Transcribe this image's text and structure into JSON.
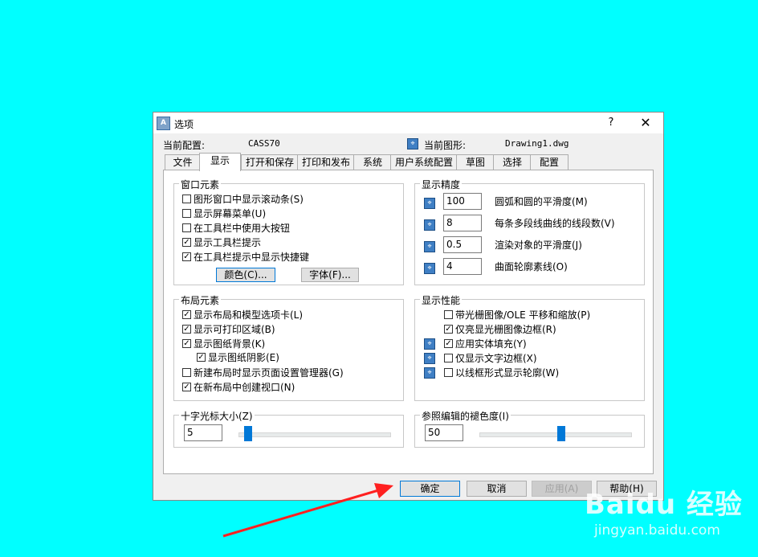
{
  "dialog": {
    "title": "选项",
    "help_label": "?",
    "close_label": "✕",
    "app_icon_label": "A"
  },
  "profile": {
    "current_config_label": "当前配置:",
    "current_config_value": "CASS70",
    "current_drawing_label": "当前图形:",
    "current_drawing_value": "Drawing1.dwg"
  },
  "tabs": [
    "文件",
    "显示",
    "打开和保存",
    "打印和发布",
    "系统",
    "用户系统配置",
    "草图",
    "选择",
    "配置"
  ],
  "active_tab": "显示",
  "window_elements": {
    "title": "窗口元素",
    "items": [
      {
        "label": "图形窗口中显示滚动条(S)",
        "checked": false
      },
      {
        "label": "显示屏幕菜单(U)",
        "checked": false
      },
      {
        "label": "在工具栏中使用大按钮",
        "checked": false
      },
      {
        "label": "显示工具栏提示",
        "checked": true
      },
      {
        "label": "在工具栏提示中显示快捷键",
        "checked": true
      }
    ],
    "colors_button": "颜色(C)...",
    "fonts_button": "字体(F)..."
  },
  "layout_elements": {
    "title": "布局元素",
    "items": [
      {
        "label": "显示布局和模型选项卡(L)",
        "checked": true
      },
      {
        "label": "显示可打印区域(B)",
        "checked": true
      },
      {
        "label": "显示图纸背景(K)",
        "checked": true
      },
      {
        "label": "显示图纸阴影(E)",
        "checked": true
      },
      {
        "label": "新建布局时显示页面设置管理器(G)",
        "checked": false
      },
      {
        "label": "在新布局中创建视口(N)",
        "checked": true
      }
    ]
  },
  "crosshair": {
    "title": "十字光标大小(Z)",
    "value": "5",
    "slider_fraction": 0.05
  },
  "display_resolution": {
    "title": "显示精度",
    "items": [
      {
        "value": "100",
        "label": "圆弧和圆的平滑度(M)"
      },
      {
        "value": "8",
        "label": "每条多段线曲线的线段数(V)"
      },
      {
        "value": "0.5",
        "label": "渲染对象的平滑度(J)"
      },
      {
        "value": "4",
        "label": "曲面轮廓素线(O)"
      }
    ]
  },
  "display_performance": {
    "title": "显示性能",
    "items": [
      {
        "label": "带光栅图像/OLE 平移和缩放(P)",
        "checked": false,
        "icon": false
      },
      {
        "label": "仅亮显光栅图像边框(R)",
        "checked": true,
        "icon": false
      },
      {
        "label": "应用实体填充(Y)",
        "checked": true,
        "icon": true
      },
      {
        "label": "仅显示文字边框(X)",
        "checked": false,
        "icon": true
      },
      {
        "label": "以线框形式显示轮廓(W)",
        "checked": false,
        "icon": true
      }
    ]
  },
  "xref_fade": {
    "title": "参照编辑的褪色度(I)",
    "value": "50",
    "slider_fraction": 0.5
  },
  "buttons": {
    "ok": "确定",
    "cancel": "取消",
    "apply": "应用(A)",
    "help": "帮助(H)"
  },
  "watermark": {
    "brand": "Baidu 经验",
    "url": "jingyan.baidu.com"
  },
  "colors": {
    "background": "#00ffff",
    "slider_thumb": "#0078d7",
    "arrow": "#ff2020"
  }
}
